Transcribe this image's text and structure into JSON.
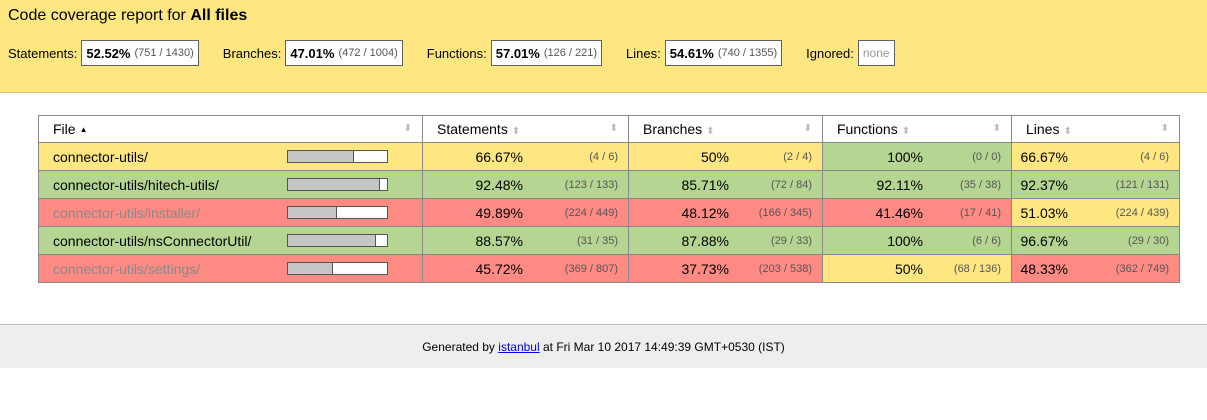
{
  "header": {
    "title_prefix": "Code coverage report for",
    "title_bold": "All files",
    "metrics": [
      {
        "label": "Statements:",
        "pct": "52.52%",
        "frac": "(751 / 1430)"
      },
      {
        "label": "Branches:",
        "pct": "47.01%",
        "frac": "(472 / 1004)"
      },
      {
        "label": "Functions:",
        "pct": "57.01%",
        "frac": "(126 / 221)"
      },
      {
        "label": "Lines:",
        "pct": "54.61%",
        "frac": "(740 / 1355)"
      }
    ],
    "ignored_label": "Ignored:",
    "ignored_value": "none"
  },
  "table": {
    "columns": [
      "File",
      "Statements",
      "Branches",
      "Functions",
      "Lines"
    ],
    "rows": [
      {
        "file": "connector-utils/",
        "bar": 0.6667,
        "stmt_pct": "66.67%",
        "stmt_frac": "(4 / 6)",
        "br_pct": "50%",
        "br_frac": "(2 / 4)",
        "fn_pct": "100%",
        "fn_frac": "(0 / 0)",
        "ln_pct": "66.67%",
        "ln_frac": "(4 / 6)"
      },
      {
        "file": "connector-utils/hitech-utils/",
        "bar": 0.9248,
        "stmt_pct": "92.48%",
        "stmt_frac": "(123 / 133)",
        "br_pct": "85.71%",
        "br_frac": "(72 / 84)",
        "fn_pct": "92.11%",
        "fn_frac": "(35 / 38)",
        "ln_pct": "92.37%",
        "ln_frac": "(121 / 131)"
      },
      {
        "file": "connector-utils/installer/",
        "bar": 0.4989,
        "stmt_pct": "49.89%",
        "stmt_frac": "(224 / 449)",
        "br_pct": "48.12%",
        "br_frac": "(166 / 345)",
        "fn_pct": "41.46%",
        "fn_frac": "(17 / 41)",
        "ln_pct": "51.03%",
        "ln_frac": "(224 / 439)"
      },
      {
        "file": "connector-utils/nsConnectorUtil/",
        "bar": 0.8857,
        "stmt_pct": "88.57%",
        "stmt_frac": "(31 / 35)",
        "br_pct": "87.88%",
        "br_frac": "(29 / 33)",
        "fn_pct": "100%",
        "fn_frac": "(6 / 6)",
        "ln_pct": "96.67%",
        "ln_frac": "(29 / 30)"
      },
      {
        "file": "connector-utils/settings/",
        "bar": 0.4572,
        "stmt_pct": "45.72%",
        "stmt_frac": "(369 / 807)",
        "br_pct": "37.73%",
        "br_frac": "(203 / 538)",
        "fn_pct": "50%",
        "fn_frac": "(68 / 136)",
        "ln_pct": "48.33%",
        "ln_frac": "(362 / 749)"
      }
    ]
  },
  "footer": {
    "prefix": "Generated by",
    "link": "istanbul",
    "suffix": "at Fri Mar 10 2017 14:49:39 GMT+0530 (IST)"
  },
  "colors": {
    "high": "#b5d592",
    "medium": "#fee781",
    "low": "#fe8a84"
  }
}
